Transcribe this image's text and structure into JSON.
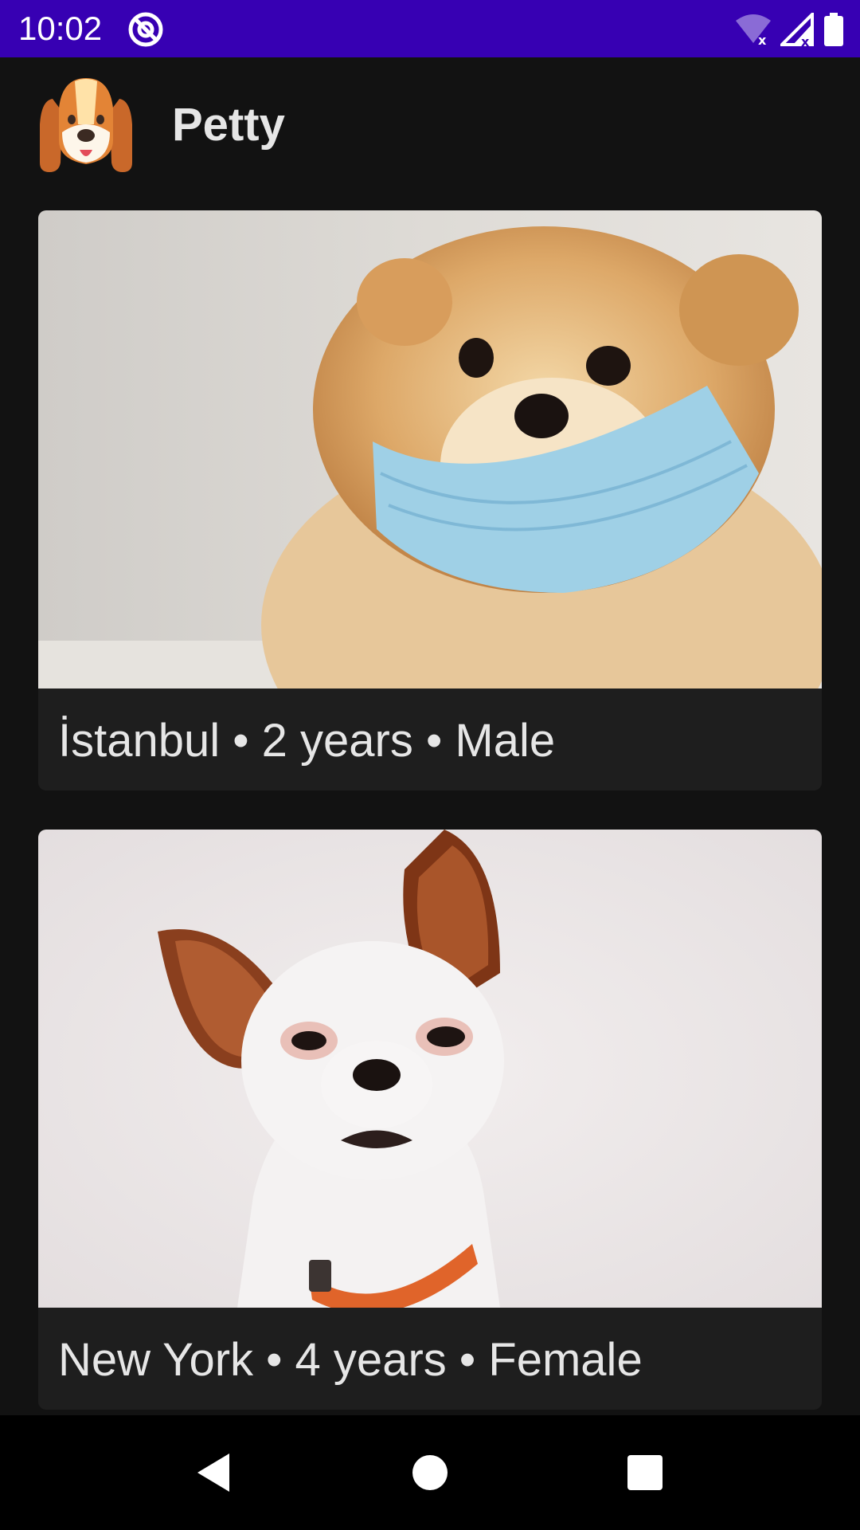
{
  "status_bar": {
    "time": "10:02",
    "background": "#3700B3",
    "icons": [
      "at-sign-icon",
      "wifi-off-icon",
      "cellular-off-icon",
      "battery-icon"
    ]
  },
  "app": {
    "title": "Petty",
    "logo_icon": "dog-face-icon"
  },
  "pets": [
    {
      "caption": "İstanbul • 2 years • Male",
      "photo_icon": "pomeranian-with-mask-photo"
    },
    {
      "caption": "New York • 4 years • Female",
      "photo_icon": "chihuahua-with-collar-photo"
    }
  ],
  "nav_bar": {
    "buttons": [
      "back-icon",
      "home-icon",
      "recents-icon"
    ]
  },
  "colors": {
    "background": "#121212",
    "card": "#1e1e1e",
    "text": "#e6e6e6",
    "status_bar": "#3700B3",
    "nav_bar": "#000000"
  }
}
